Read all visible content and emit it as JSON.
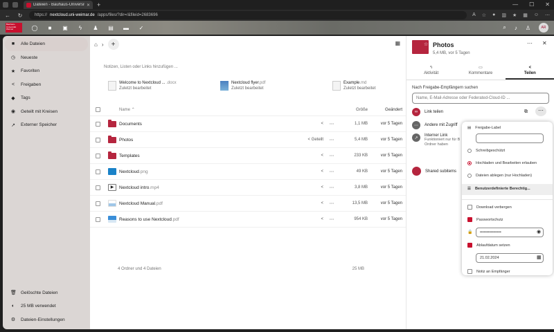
{
  "browser": {
    "tab_title": "Dateien - Bauhaus-Universität W",
    "url_host": "nextcloud.uni-weimar.de",
    "url_path": "/apps/files/?dir=/&fileid=2683696",
    "url_scheme": "https://"
  },
  "header": {
    "logo_text": "Bauhaus-Universität Weimar",
    "avatar_initials": "AR"
  },
  "sidebar": {
    "items": [
      {
        "label": "Alle Dateien",
        "icon": "folder-icon"
      },
      {
        "label": "Neueste",
        "icon": "clock-icon"
      },
      {
        "label": "Favoriten",
        "icon": "star-icon"
      },
      {
        "label": "Freigaben",
        "icon": "share-icon"
      },
      {
        "label": "Tags",
        "icon": "tag-icon"
      },
      {
        "label": "Geteilt mit Kreisen",
        "icon": "circles-icon"
      },
      {
        "label": "Externer Speicher",
        "icon": "external-icon"
      }
    ],
    "bottom": [
      {
        "label": "Gelöschte Dateien",
        "icon": "trash-icon"
      },
      {
        "label": "25 MB verwendet",
        "icon": "quota-icon"
      },
      {
        "label": "Dateien-Einstellungen",
        "icon": "gear-icon"
      }
    ]
  },
  "main": {
    "notes_placeholder": "Notizen, Listen oder Links hinzufügen ...",
    "recent": [
      {
        "name": "Welcome to Nextcloud ...",
        "ext": ".docx",
        "sub": "Zuletzt bearbeitet"
      },
      {
        "name": "Nextcloud flyer",
        "ext": ".pdf",
        "sub": "Zuletzt bearbeitet"
      },
      {
        "name": "Example",
        "ext": ".md",
        "sub": "Zuletzt bearbeitet"
      }
    ],
    "columns": {
      "name": "Name",
      "size": "Größe",
      "modified": "Geändert"
    },
    "rows": [
      {
        "name": "Documents",
        "ext": "",
        "shared": "",
        "size": "1,1 MB",
        "modified": "vor 5 Tagen",
        "kind": "folder"
      },
      {
        "name": "Photos",
        "ext": "",
        "shared": "Geteilt",
        "size": "5,4 MB",
        "modified": "vor 5 Tagen",
        "kind": "folder-link"
      },
      {
        "name": "Templates",
        "ext": "",
        "shared": "",
        "size": "233 KB",
        "modified": "vor 5 Tagen",
        "kind": "folder"
      },
      {
        "name": "Nextcloud",
        "ext": ".png",
        "shared": "",
        "size": "49 KB",
        "modified": "vor 5 Tagen",
        "kind": "png"
      },
      {
        "name": "Nextcloud intro",
        "ext": ".mp4",
        "shared": "",
        "size": "3,8 MB",
        "modified": "vor 5 Tagen",
        "kind": "video"
      },
      {
        "name": "Nextcloud Manual",
        "ext": ".pdf",
        "shared": "",
        "size": "13,5 MB",
        "modified": "vor 5 Tagen",
        "kind": "pdf"
      },
      {
        "name": "Reasons to use Nextcloud",
        "ext": ".pdf",
        "shared": "",
        "size": "954 KB",
        "modified": "vor 5 Tagen",
        "kind": "pdf2"
      }
    ],
    "footer_summary": "4 Ordner und 4 Dateien",
    "footer_size": "25 MB"
  },
  "details": {
    "title": "Photos",
    "subtitle": "5,4 MB, vor 5 Tagen",
    "tabs": [
      "Aktivität",
      "Kommentare",
      "Teilen"
    ],
    "share_label": "Nach Freigabe-Empfängern suchen",
    "share_placeholder": "Name, E-Mail-Adresse oder Federated-Cloud-ID ...",
    "link_share": "Link teilen",
    "others_access": "Andere mit Zugriff",
    "internal_link": "Interner Link",
    "internal_sub1": "Funktioniert nur für B",
    "internal_sub2": "Ordner haben",
    "shared_subitems": "Shared subitems"
  },
  "popup": {
    "label_field": "Freigabe-Label",
    "readonly": "Schreibgeschützt",
    "upload_edit": "Hochladen und Bearbeiten erlauben",
    "file_drop": "Dateien ablegen (nur Hochladen)",
    "custom_perms": "Benutzerdefinierte Berechtig...",
    "hide_download": "Download verbergen",
    "password_protect": "Passwortschutz",
    "password_value": "••••••••••••••••",
    "expiry": "Ablaufdatum setzen",
    "expiry_date": "21.02.2024",
    "note": "Notiz an Empfänger"
  }
}
